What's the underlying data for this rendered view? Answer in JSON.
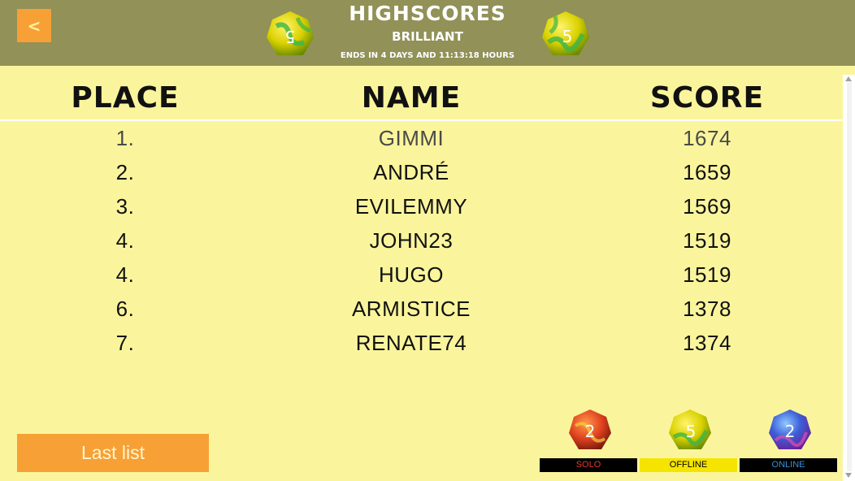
{
  "header": {
    "back_label": "<",
    "title": "HIGHSCORES",
    "subtitle": "BRILLIANT",
    "ends_text": "ENDS IN 4 DAYS AND 11:13:18 HOURS",
    "die_left_number": "5",
    "die_right_number": "5"
  },
  "columns": {
    "place": "PLACE",
    "name": "NAME",
    "score": "SCORE"
  },
  "scores": [
    {
      "place": "1.",
      "name": "GIMMI",
      "score": "1674"
    },
    {
      "place": "2.",
      "name": "ANDRÉ",
      "score": "1659"
    },
    {
      "place": "3.",
      "name": "EVILEMMY",
      "score": "1569"
    },
    {
      "place": "4.",
      "name": "JOHN23",
      "score": "1519"
    },
    {
      "place": "4.",
      "name": "HUGO",
      "score": "1519"
    },
    {
      "place": "6.",
      "name": "ARMISTICE",
      "score": "1378"
    },
    {
      "place": "7.",
      "name": "RENATE74",
      "score": "1374"
    }
  ],
  "footer": {
    "last_list_label": "Last list",
    "modes": [
      {
        "label": "SOLO",
        "die_number": "2",
        "label_color": "#e23b2e",
        "label_bg": "#000000"
      },
      {
        "label": "OFFLINE",
        "die_number": "5",
        "label_color": "#000000",
        "label_bg": "#f5e400"
      },
      {
        "label": "ONLINE",
        "die_number": "2",
        "label_color": "#3a8fd8",
        "label_bg": "#000000"
      }
    ]
  },
  "colors": {
    "header_bg": "#919158",
    "page_bg": "#faf59c",
    "accent_orange": "#f7a035"
  }
}
